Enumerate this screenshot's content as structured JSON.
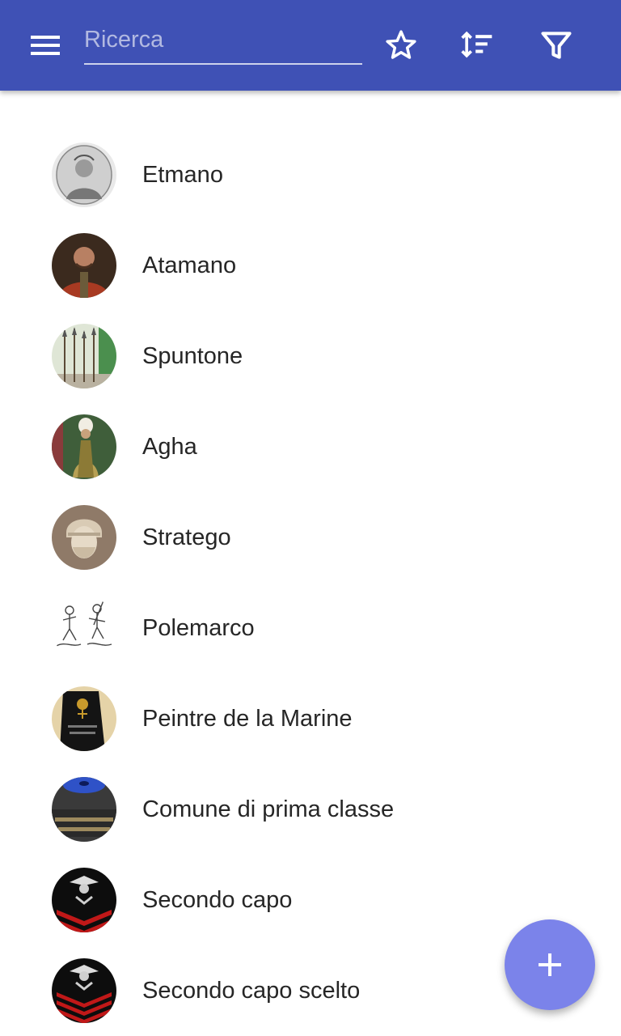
{
  "theme": {
    "appbar_color": "#3f51b5",
    "fab_color": "#7b83ea",
    "text_color": "#262626"
  },
  "appbar": {
    "menu_icon": "hamburger-menu-icon",
    "search_placeholder": "Ricerca",
    "search_value": "",
    "actions": [
      {
        "icon": "star-outline-icon"
      },
      {
        "icon": "sort-icon"
      },
      {
        "icon": "filter-icon"
      }
    ]
  },
  "items": [
    {
      "label": "Etmano",
      "avatar": "engraved-portrait-image"
    },
    {
      "label": "Atamano",
      "avatar": "painted-portrait-image"
    },
    {
      "label": "Spuntone",
      "avatar": "polearms-image"
    },
    {
      "label": "Agha",
      "avatar": "ottoman-figure-image"
    },
    {
      "label": "Stratego",
      "avatar": "greek-bust-image"
    },
    {
      "label": "Polemarco",
      "avatar": "warriors-sketch-image"
    },
    {
      "label": "Peintre de la Marine",
      "avatar": "shoulder-board-image"
    },
    {
      "label": "Comune di prima classe",
      "avatar": "royal-navy-cap-image"
    },
    {
      "label": "Secondo capo",
      "avatar": "petty-officer-insignia-image"
    },
    {
      "label": "Secondo capo scelto",
      "avatar": "petty-officer-first-class-insignia-image"
    }
  ],
  "fab": {
    "icon": "plus-icon"
  }
}
